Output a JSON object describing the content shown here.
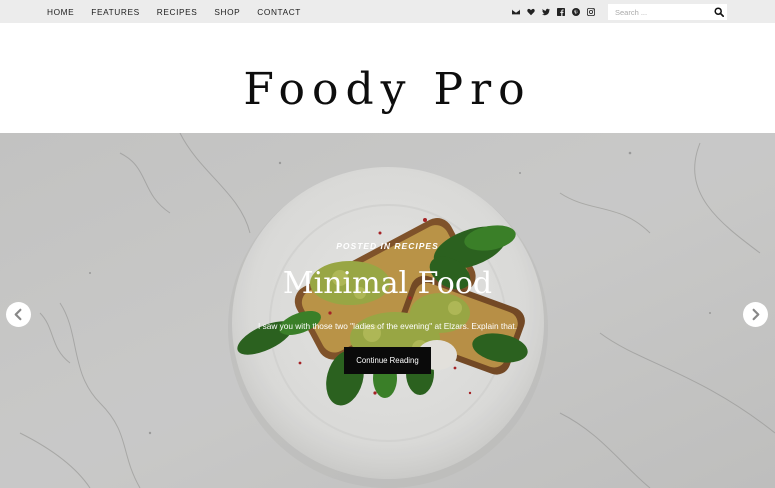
{
  "nav": {
    "items": [
      "HOME",
      "FEATURES",
      "RECIPES",
      "SHOP",
      "CONTACT"
    ]
  },
  "social": {
    "icons": [
      "envelope-icon",
      "heart-icon",
      "twitter-icon",
      "facebook-icon",
      "pinterest-icon",
      "instagram-icon"
    ]
  },
  "search": {
    "placeholder": "Search ..."
  },
  "site": {
    "title": "Foody Pro"
  },
  "slide": {
    "category_line": "POSTED IN RECIPES",
    "title": "Minimal Food",
    "excerpt": "I saw you with those two \"ladies of the evening\" at Elzars. Explain that.",
    "button_label": "Continue Reading"
  },
  "colors": {
    "topbar_bg": "#ececec",
    "button_bg": "#0a0a0a",
    "hero_marble": "#d6d6d5"
  }
}
